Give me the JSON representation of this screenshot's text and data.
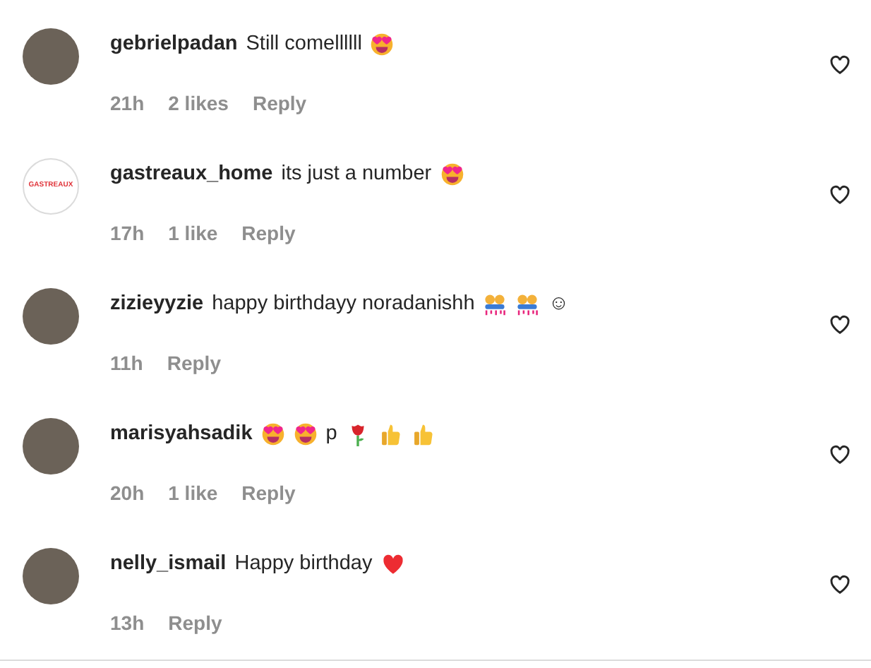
{
  "comments": [
    {
      "username": "gebrielpadan",
      "avatar": {
        "kind": "photo"
      },
      "parts": [
        {
          "kind": "text",
          "text": "Still comellllll"
        },
        {
          "kind": "heart_eyes"
        }
      ],
      "time": "21h",
      "likes": "2 likes",
      "reply": "Reply",
      "liked": false
    },
    {
      "username": "gastreaux_home",
      "avatar": {
        "kind": "logo",
        "text": "GASTREAUX"
      },
      "parts": [
        {
          "kind": "text",
          "text": "its just a number"
        },
        {
          "kind": "heart_eyes"
        }
      ],
      "time": "17h",
      "likes": "1 like",
      "reply": "Reply",
      "liked": false
    },
    {
      "username": "zizieyyzie",
      "avatar": {
        "kind": "photo"
      },
      "parts": [
        {
          "kind": "text",
          "text": "happy birthdayy noradanishh"
        },
        {
          "kind": "party_people"
        },
        {
          "kind": "party_people"
        },
        {
          "kind": "text",
          "text": "☺"
        }
      ],
      "time": "11h",
      "reply": "Reply",
      "liked": false
    },
    {
      "username": "marisyahsadik",
      "avatar": {
        "kind": "photo"
      },
      "parts": [
        {
          "kind": "heart_eyes"
        },
        {
          "kind": "heart_eyes"
        },
        {
          "kind": "text",
          "text": "p"
        },
        {
          "kind": "rose"
        },
        {
          "kind": "thumbs_up"
        },
        {
          "kind": "thumbs_up"
        }
      ],
      "time": "20h",
      "likes": "1 like",
      "reply": "Reply",
      "liked": false
    },
    {
      "username": "nelly_ismail",
      "avatar": {
        "kind": "photo"
      },
      "parts": [
        {
          "kind": "text",
          "text": "Happy birthday"
        },
        {
          "kind": "red_heart"
        }
      ],
      "time": "13h",
      "reply": "Reply",
      "liked": false
    }
  ]
}
